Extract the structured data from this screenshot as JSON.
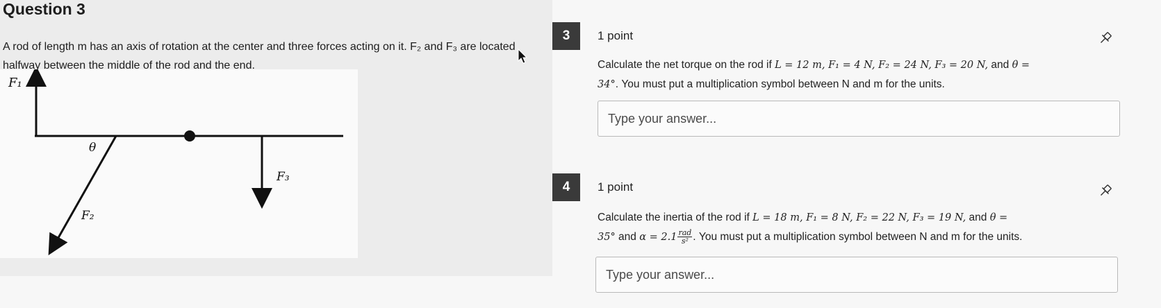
{
  "left": {
    "title": "Question 3",
    "prompt": "A rod of length m has an axis of rotation at the center and three forces acting on it. F₂ and F₃ are located halfway between the middle of the rod and the end.",
    "diagram": {
      "label_f1": "F₁",
      "label_f2": "F₂",
      "label_f3": "F₃",
      "label_theta": "θ"
    }
  },
  "questions": [
    {
      "number": "3",
      "points": "1 point",
      "line1_prefix": "Calculate the net torque on the rod if",
      "line1_math": "L = 12 m, F₁ = 4 N, F₂ = 24 N, F₃ = 20 N,",
      "line1_mid": "and",
      "line1_end": "θ =",
      "line2_math": "34°",
      "line2_text": ". You must put a multiplication symbol between N and m for the units.",
      "answer_placeholder": "Type your answer..."
    },
    {
      "number": "4",
      "points": "1 point",
      "line1_prefix": "Calculate the inertia of the rod if",
      "line1_math": "L = 18 m, F₁ = 8 N, F₂ = 22 N, F₃ = 19 N,",
      "line1_mid": "and",
      "line1_end": "θ =",
      "line2_math": "35°",
      "line2_and": "and",
      "line2_alpha": "α = 2.1",
      "line2_frac_num": "rad",
      "line2_frac_den": "s²",
      "line2_text": ". You must put a multiplication symbol between N and m for the units.",
      "answer_placeholder": "Type your answer..."
    }
  ],
  "icons": {
    "pin": "pin-icon",
    "cursor": "mouse-cursor-icon"
  }
}
